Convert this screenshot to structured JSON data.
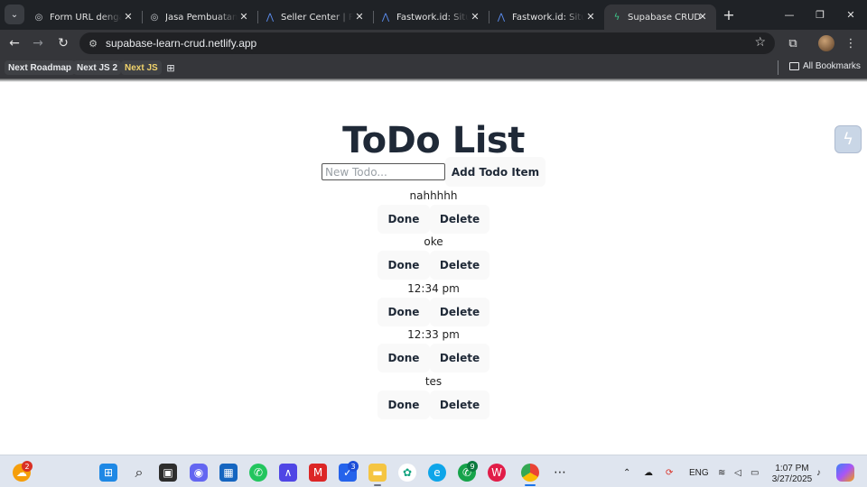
{
  "browser": {
    "tabs": [
      {
        "title": "Form URL dengan",
        "icon": "globe-icon"
      },
      {
        "title": "Jasa Pembuatan W",
        "icon": "globe-icon"
      },
      {
        "title": "Seller Center | Fast",
        "icon": "fastwork-icon"
      },
      {
        "title": "Fastwork.id: Situs F",
        "icon": "fastwork-icon"
      },
      {
        "title": "Fastwork.id: Situs F",
        "icon": "fastwork-icon"
      },
      {
        "title": "Supabase CRUD",
        "icon": "supabase-icon",
        "active": true
      }
    ],
    "url": "supabase-learn-crud.netlify.app",
    "bookmarks": [
      {
        "label": "Next Roadmap"
      },
      {
        "label": "Next JS 2"
      },
      {
        "label": "Next JS"
      }
    ],
    "all_bookmarks_label": "All Bookmarks"
  },
  "page": {
    "title": "ToDo List",
    "input_placeholder": "New Todo...",
    "add_label": "Add Todo Item",
    "done_label": "Done",
    "delete_label": "Delete",
    "todos": [
      "nahhhhh",
      "oke",
      "12:34 pm",
      "12:33 pm",
      "tes"
    ]
  },
  "taskbar": {
    "badges": {
      "weather": "2",
      "todo_app": "3",
      "whatsapp": "9"
    },
    "language": "ENG",
    "time": "1:07 PM",
    "date": "3/27/2025"
  }
}
